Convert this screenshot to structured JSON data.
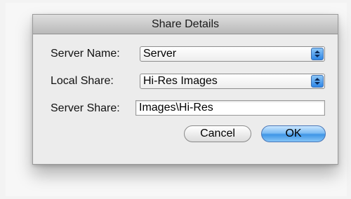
{
  "dialog": {
    "title": "Share Details",
    "fields": {
      "server_name": {
        "label": "Server Name:",
        "value": "Server"
      },
      "local_share": {
        "label": "Local Share:",
        "value": "Hi-Res Images"
      },
      "server_share": {
        "label": "Server Share:",
        "value": "Images\\Hi-Res"
      }
    },
    "buttons": {
      "cancel": "Cancel",
      "ok": "OK"
    }
  },
  "icons": {
    "popup_arrows": "updown-arrows-icon"
  },
  "colors": {
    "accent": "#3f95e6"
  }
}
